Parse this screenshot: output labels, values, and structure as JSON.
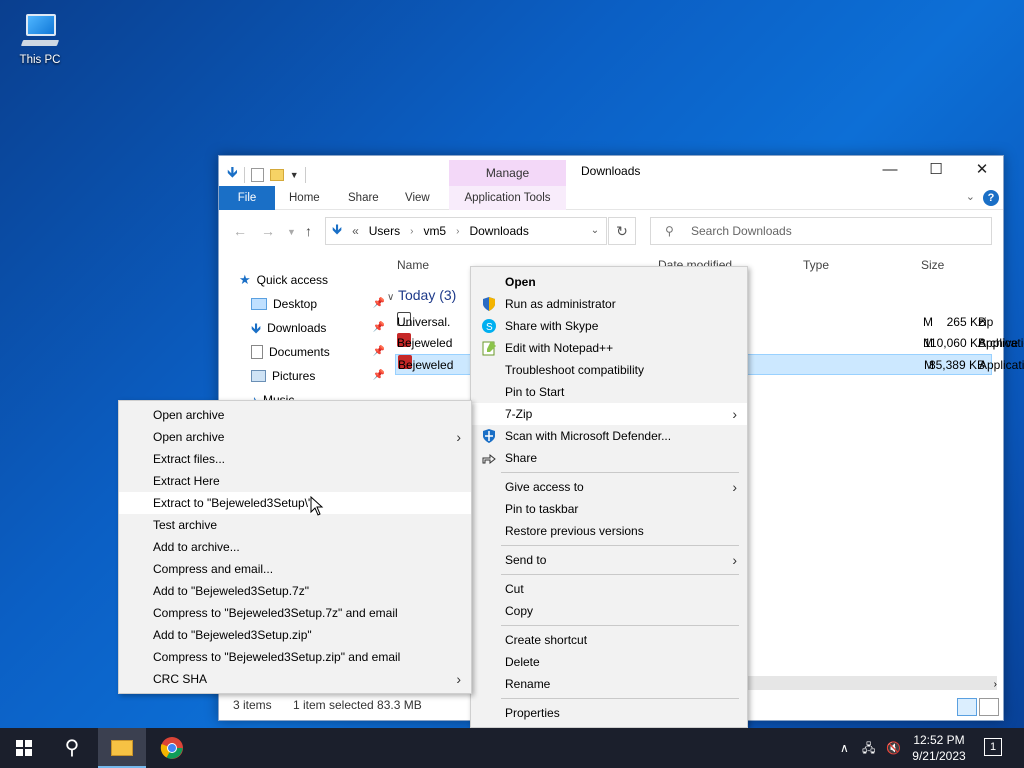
{
  "desktop": {
    "this_pc_label": "This PC"
  },
  "window": {
    "title": "Downloads",
    "manage_tab": "Manage",
    "ribbon_tabs": [
      "File",
      "Home",
      "Share",
      "View",
      "Application Tools"
    ],
    "controls": {
      "minimize": "—",
      "maximize": "☐",
      "close": "✕"
    }
  },
  "address": {
    "prefix": "«",
    "crumbs": [
      "Users",
      "vm5",
      "Downloads"
    ],
    "search_placeholder": "Search Downloads"
  },
  "navpane": {
    "items": [
      {
        "label": "Quick access",
        "pinned": false
      },
      {
        "label": "Desktop",
        "pinned": true
      },
      {
        "label": "Downloads",
        "pinned": true
      },
      {
        "label": "Documents",
        "pinned": true
      },
      {
        "label": "Pictures",
        "pinned": true
      },
      {
        "label": "Music",
        "pinned": false
      }
    ]
  },
  "filelist": {
    "columns": [
      "Name",
      "Date modified",
      "Type",
      "Size"
    ],
    "group": "Today (3)",
    "rows": [
      {
        "name": "Universal.",
        "date": "M",
        "type": "zip Archive",
        "size": "265 KB",
        "selected": false
      },
      {
        "name": "Bejeweled",
        "date": "M",
        "type": "Application",
        "size": "110,060 KB",
        "selected": false
      },
      {
        "name": "Bejeweled",
        "date": "M",
        "type": "Application",
        "size": "85,389 KB",
        "selected": true
      }
    ]
  },
  "status": {
    "items_count": "3 items",
    "selection": "1 item selected  83.3 MB"
  },
  "context_menu": {
    "groups": [
      [
        {
          "label": "Open",
          "bold": true,
          "icon": ""
        },
        {
          "label": "Run as administrator",
          "icon": "shield-icon"
        },
        {
          "label": "Share with Skype",
          "icon": "skype-icon"
        },
        {
          "label": "Edit with Notepad++",
          "icon": "notepadpp-icon"
        },
        {
          "label": "Troubleshoot compatibility",
          "icon": ""
        },
        {
          "label": "Pin to Start",
          "icon": ""
        },
        {
          "label": "7-Zip",
          "icon": "",
          "submenu": true,
          "highlighted": true
        },
        {
          "label": "Scan with Microsoft Defender...",
          "icon": "defender-icon"
        },
        {
          "label": "Share",
          "icon": "share-icon"
        }
      ],
      [
        {
          "label": "Give access to",
          "submenu": true
        },
        {
          "label": "Pin to taskbar"
        },
        {
          "label": "Restore previous versions"
        }
      ],
      [
        {
          "label": "Send to",
          "submenu": true
        }
      ],
      [
        {
          "label": "Cut"
        },
        {
          "label": "Copy"
        }
      ],
      [
        {
          "label": "Create shortcut"
        },
        {
          "label": "Delete"
        },
        {
          "label": "Rename"
        }
      ],
      [
        {
          "label": "Properties"
        }
      ]
    ]
  },
  "sevenzip_menu": {
    "items": [
      {
        "label": "Open archive"
      },
      {
        "label": "Open archive",
        "submenu": true
      },
      {
        "label": "Extract files..."
      },
      {
        "label": "Extract Here"
      },
      {
        "label": "Extract to \"Bejeweled3Setup\\\"",
        "highlighted": true
      },
      {
        "label": "Test archive"
      },
      {
        "label": "Add to archive..."
      },
      {
        "label": "Compress and email..."
      },
      {
        "label": "Add to \"Bejeweled3Setup.7z\""
      },
      {
        "label": "Compress to \"Bejeweled3Setup.7z\" and email"
      },
      {
        "label": "Add to \"Bejeweled3Setup.zip\""
      },
      {
        "label": "Compress to \"Bejeweled3Setup.zip\" and email"
      },
      {
        "label": "CRC SHA",
        "submenu": true
      }
    ]
  },
  "taskbar": {
    "clock_time": "12:52 PM",
    "clock_date": "9/21/2023",
    "notification_count": "1"
  },
  "colors": {
    "accent": "#1a6fc6",
    "selection": "#cce8ff",
    "manage_tab": "#f3d8f8"
  }
}
